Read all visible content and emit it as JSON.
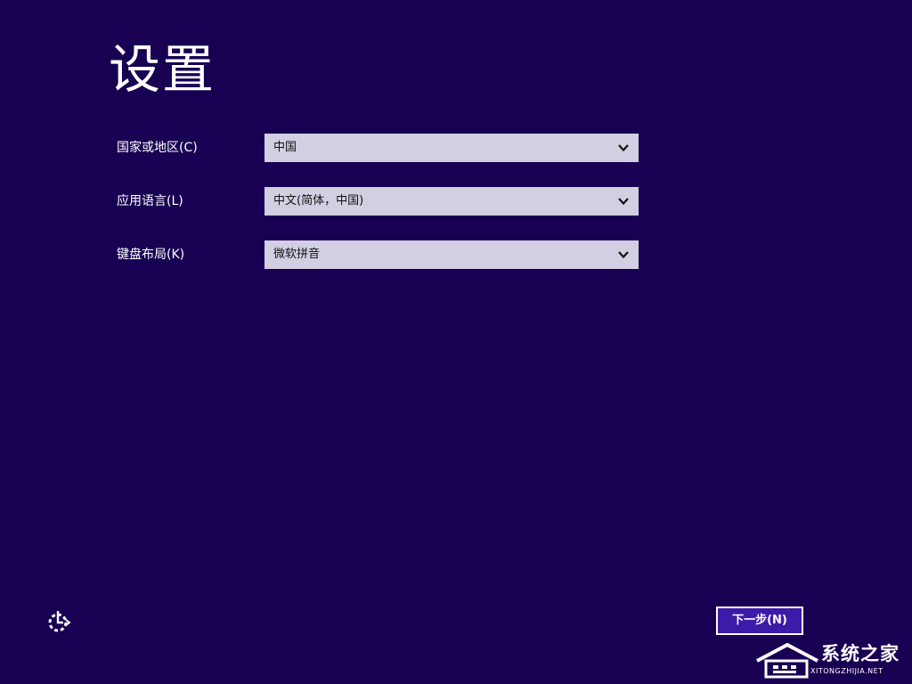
{
  "page": {
    "title": "设置",
    "background_color": "#180052"
  },
  "form": {
    "rows": [
      {
        "label": "国家或地区(C)",
        "value": "中国"
      },
      {
        "label": "应用语言(L)",
        "value": "中文(简体，中国)"
      },
      {
        "label": "键盘布局(K)",
        "value": "微软拼音"
      }
    ]
  },
  "footer": {
    "settings_icon": "gear-clock-icon",
    "next_label": "下一步(N)"
  },
  "watermark": {
    "title": "系统之家",
    "subtitle": "XITONGZHIJIA.NET"
  },
  "colors": {
    "accent": "#3c1ba8",
    "select_bg": "#d3cfe2"
  }
}
